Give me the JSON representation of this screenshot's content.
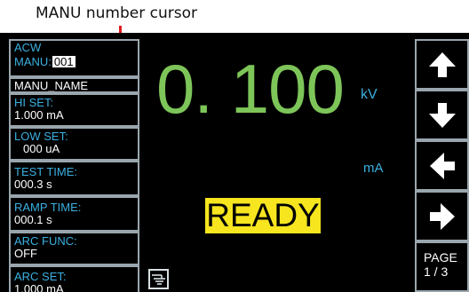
{
  "annotation": {
    "label": "MANU number cursor",
    "color": "#e0191f"
  },
  "sidebar": {
    "mode": "ACW",
    "manu_label": "MANU:",
    "manu_value": "001",
    "manu_name": "MANU_NAME",
    "params": [
      {
        "label": "HI SET:",
        "value": "1.000 mA"
      },
      {
        "label": "LOW SET:",
        "value": "000 uA"
      },
      {
        "label": "TEST TIME:",
        "value": "000.3 s"
      },
      {
        "label": "RAMP TIME:",
        "value": "000.1 s"
      },
      {
        "label": "ARC FUNC:",
        "value": "OFF"
      },
      {
        "label": "ARC SET:",
        "value": "1.000 mA"
      }
    ]
  },
  "main": {
    "voltage": "0. 100",
    "voltage_unit": "kV",
    "current_unit": "mA",
    "status": "READY",
    "colors": {
      "voltage": "#7dc559",
      "label": "#3bb0e0",
      "status_bg": "#f6e51f"
    }
  },
  "softkeys": {
    "icons": [
      "arrow-up-icon",
      "arrow-down-icon",
      "arrow-left-icon",
      "arrow-right-icon"
    ],
    "page_label": "PAGE",
    "page_value": "1 / 3"
  }
}
